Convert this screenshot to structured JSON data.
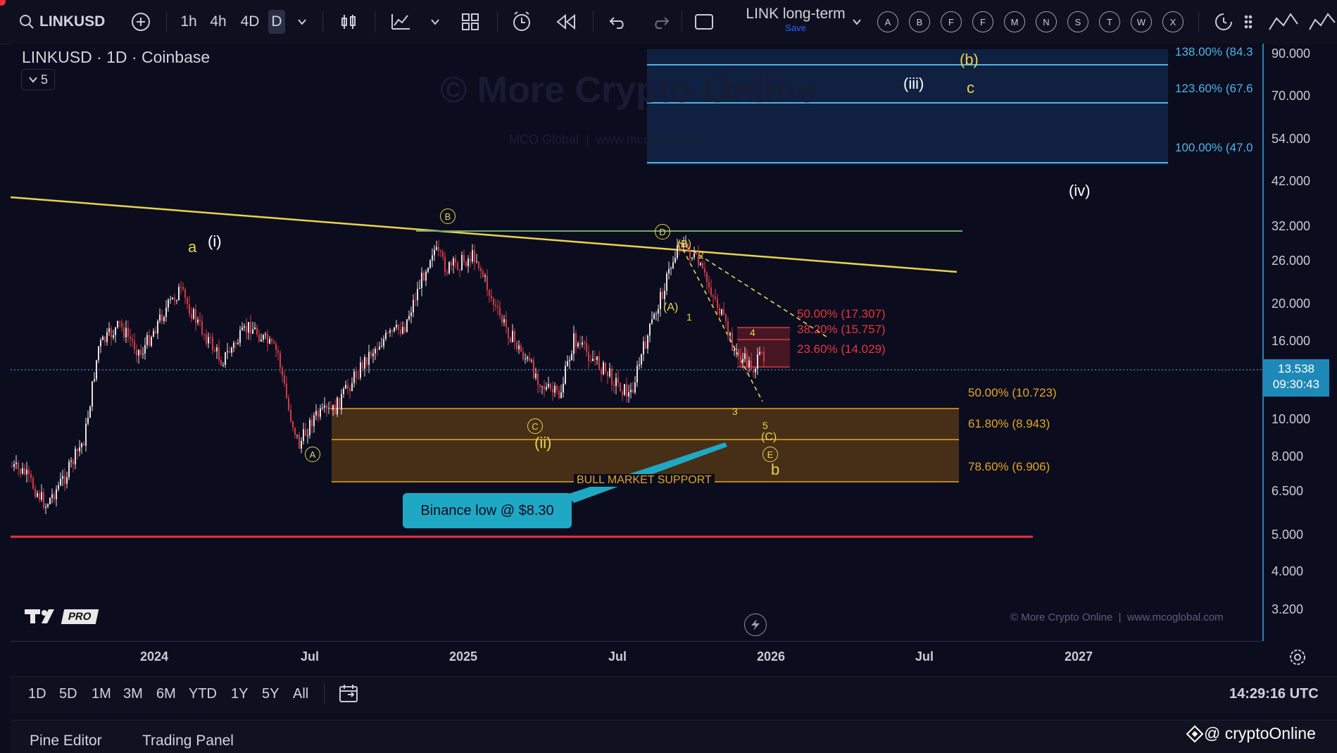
{
  "toolbar": {
    "symbol": "LINKUSD",
    "intervals": [
      "1h",
      "4h",
      "4D",
      "D"
    ],
    "layout_name": "LINK long-term",
    "save_label": "Save",
    "circle_letters": [
      "A",
      "B",
      "F",
      "F",
      "M",
      "N",
      "S",
      "T",
      "W",
      "X"
    ]
  },
  "chart": {
    "legend_title": "LINKUSD · 1D · Coinbase",
    "collapse_count": "5",
    "watermark": "© More Crypto Online",
    "watermark_sub": "MCO Global  |  www.mcoglobal.com",
    "footer_watermark": "© More Crypto Online  |  www.mcoglobal.com",
    "tv_badge": "PRO",
    "price_axis": [
      "90.000",
      "70.000",
      "54.000",
      "42.000",
      "32.000",
      "26.000",
      "20.000",
      "16.000",
      "10.000",
      "8.000",
      "6.500",
      "5.000",
      "4.000",
      "3.200"
    ],
    "current_price": "13.538",
    "countdown": "09:30:43",
    "time_axis": [
      "2024",
      "Jul",
      "2025",
      "Jul",
      "2026",
      "Jul",
      "2027"
    ],
    "fib_upper": [
      "138.00% (84.3",
      "123.60% (67.6",
      "100.00% (47.0"
    ],
    "fib_mid": [
      "50.00% (17.307)",
      "38.20% (15.757)",
      "23.60% (14.029)"
    ],
    "fib_lower": [
      "50.00% (10.723)",
      "61.80% (8.943)",
      "78.60% (6.906)"
    ],
    "support_label": "BULL MARKET SUPPORT",
    "callout": "Binance low @ $8.30",
    "wave_labels": {
      "a": "a",
      "i": "(i)",
      "ii": "(ii)",
      "iii": "(iii)",
      "iv": "(iv)",
      "b_paren": "(b)",
      "c": "c",
      "b": "b",
      "A_paren": "(A)",
      "B_paren": "(B)",
      "C_paren": "(C)",
      "n1": "1",
      "n2": "2",
      "n3": "3",
      "n4": "4",
      "n5": "5",
      "circA": "A",
      "circB": "B",
      "circC": "C",
      "circD": "D",
      "circE": "E"
    }
  },
  "bottom": {
    "ranges": [
      "1D",
      "5D",
      "1M",
      "3M",
      "6M",
      "YTD",
      "1Y",
      "5Y",
      "All"
    ],
    "clock": "14:29:16 UTC",
    "panels": [
      "Pine Editor",
      "Trading Panel"
    ],
    "credit": "@ cryptoOnline"
  },
  "colors": {
    "yellow": "#e8d44d",
    "orange": "#e6a520",
    "fib_blue": "#4fb3e8",
    "red": "#e8333f",
    "teal": "#1fa8c4",
    "green": "#6fa86a",
    "candle_up": "#e8e0e0",
    "candle_down": "#d23a45",
    "price_tag": "#1e88b8"
  }
}
